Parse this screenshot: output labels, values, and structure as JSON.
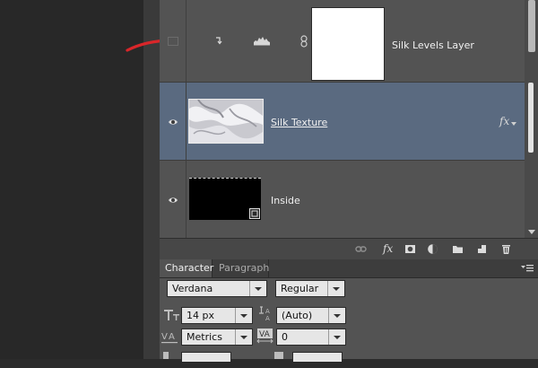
{
  "layers": [
    {
      "name": "Silk Levels Layer",
      "visible": false,
      "type": "levels-adjustment"
    },
    {
      "name": "Silk Texture",
      "visible": true,
      "selected": true,
      "has_fx": true
    },
    {
      "name": "Inside",
      "visible": true
    }
  ],
  "layers_toolbar": [
    "link-layers",
    "fx",
    "add-mask",
    "adjustment-layer",
    "new-group",
    "new-layer",
    "delete-layer"
  ],
  "character_panel": {
    "tabs": [
      {
        "label": "Character",
        "active": true
      },
      {
        "label": "Paragraph",
        "active": false
      }
    ],
    "font_family": "Verdana",
    "font_style": "Regular",
    "font_size": "14 px",
    "leading": "(Auto)",
    "kerning": "Metrics",
    "tracking": "0"
  },
  "colors": {
    "panel_bg": "#535353",
    "selected_row": "#5a6a80",
    "annotation_arrow": "#d9262a"
  }
}
